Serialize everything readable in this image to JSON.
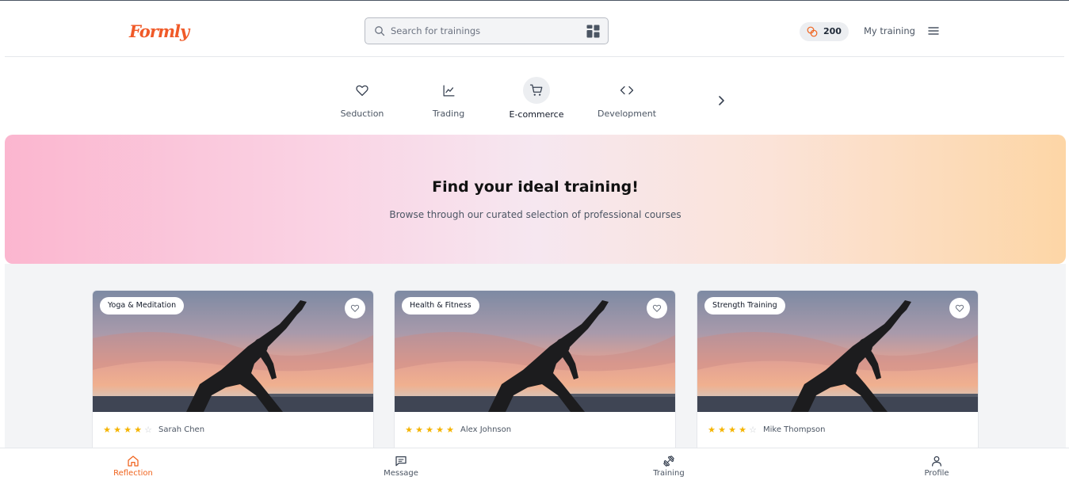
{
  "header": {
    "logo_text": "Formly",
    "search": {
      "placeholder": "Search for trainings",
      "value": ""
    },
    "coins": "200",
    "my_training": "My training"
  },
  "categories": [
    {
      "label": "Seduction",
      "icon": "heart-icon",
      "active": false
    },
    {
      "label": "Trading",
      "icon": "chart-line-icon",
      "active": false
    },
    {
      "label": "E-commerce",
      "icon": "shopping-cart-icon",
      "active": true
    },
    {
      "label": "Development",
      "icon": "code-icon",
      "active": false
    }
  ],
  "hero": {
    "title": "Find your ideal training!",
    "subtitle": "Browse through our curated selection of professional courses"
  },
  "courses": [
    {
      "tag": "Yoga & Meditation",
      "rating": 4,
      "max_rating": 5,
      "author": "Sarah Chen",
      "image": "yoga-sunset-silhouette"
    },
    {
      "tag": "Health & Fitness",
      "rating": 5,
      "max_rating": 5,
      "author": "Alex Johnson",
      "image": "yoga-sunset-silhouette"
    },
    {
      "tag": "Strength Training",
      "rating": 4,
      "max_rating": 5,
      "author": "Mike Thompson",
      "image": "yoga-sunset-silhouette"
    }
  ],
  "bottom_nav": [
    {
      "label": "Reflection",
      "icon": "home-icon",
      "active": true
    },
    {
      "label": "Message",
      "icon": "message-icon",
      "active": false
    },
    {
      "label": "Training",
      "icon": "dumbbell-icon",
      "active": false
    },
    {
      "label": "Profile",
      "icon": "user-icon",
      "active": false
    }
  ],
  "colors": {
    "accent": "#f0641e",
    "star": "#f5b400",
    "hero_left": "#fbb6cf",
    "hero_right": "#fdd6a6"
  }
}
